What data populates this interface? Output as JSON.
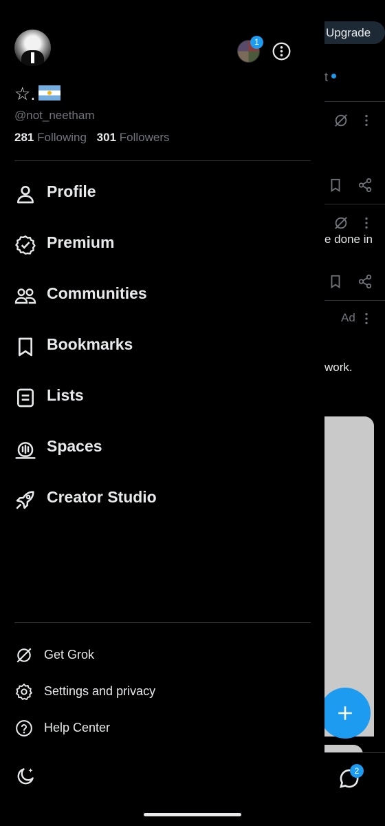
{
  "profile": {
    "display_name": "☆.",
    "handle": "@not_neetham",
    "following_count": "281",
    "following_label": "Following",
    "followers_count": "301",
    "followers_label": "Followers",
    "account_switcher_badge": "1"
  },
  "nav": {
    "items": [
      {
        "label": "Profile",
        "icon": "person-icon"
      },
      {
        "label": "Premium",
        "icon": "verified-badge-icon"
      },
      {
        "label": "Communities",
        "icon": "communities-icon"
      },
      {
        "label": "Bookmarks",
        "icon": "bookmark-icon"
      },
      {
        "label": "Lists",
        "icon": "list-icon"
      },
      {
        "label": "Spaces",
        "icon": "spaces-icon"
      },
      {
        "label": "Creator Studio",
        "icon": "rocket-icon"
      }
    ]
  },
  "secondary": {
    "items": [
      {
        "label": "Get Grok",
        "icon": "grok-icon"
      },
      {
        "label": "Settings and privacy",
        "icon": "gear-icon"
      },
      {
        "label": "Help Center",
        "icon": "help-icon"
      }
    ]
  },
  "background": {
    "upgrade_label": "Upgrade",
    "tab_fragment": "t",
    "text_fragment_1": "e done in",
    "ad_label": "Ad",
    "text_fragment_2": "work.",
    "messages_badge": "2"
  },
  "colors": {
    "background": "#000000",
    "text": "#e7e9ea",
    "secondary_text": "#71767b",
    "accent": "#1d9bf0",
    "divider": "#2f3336"
  }
}
